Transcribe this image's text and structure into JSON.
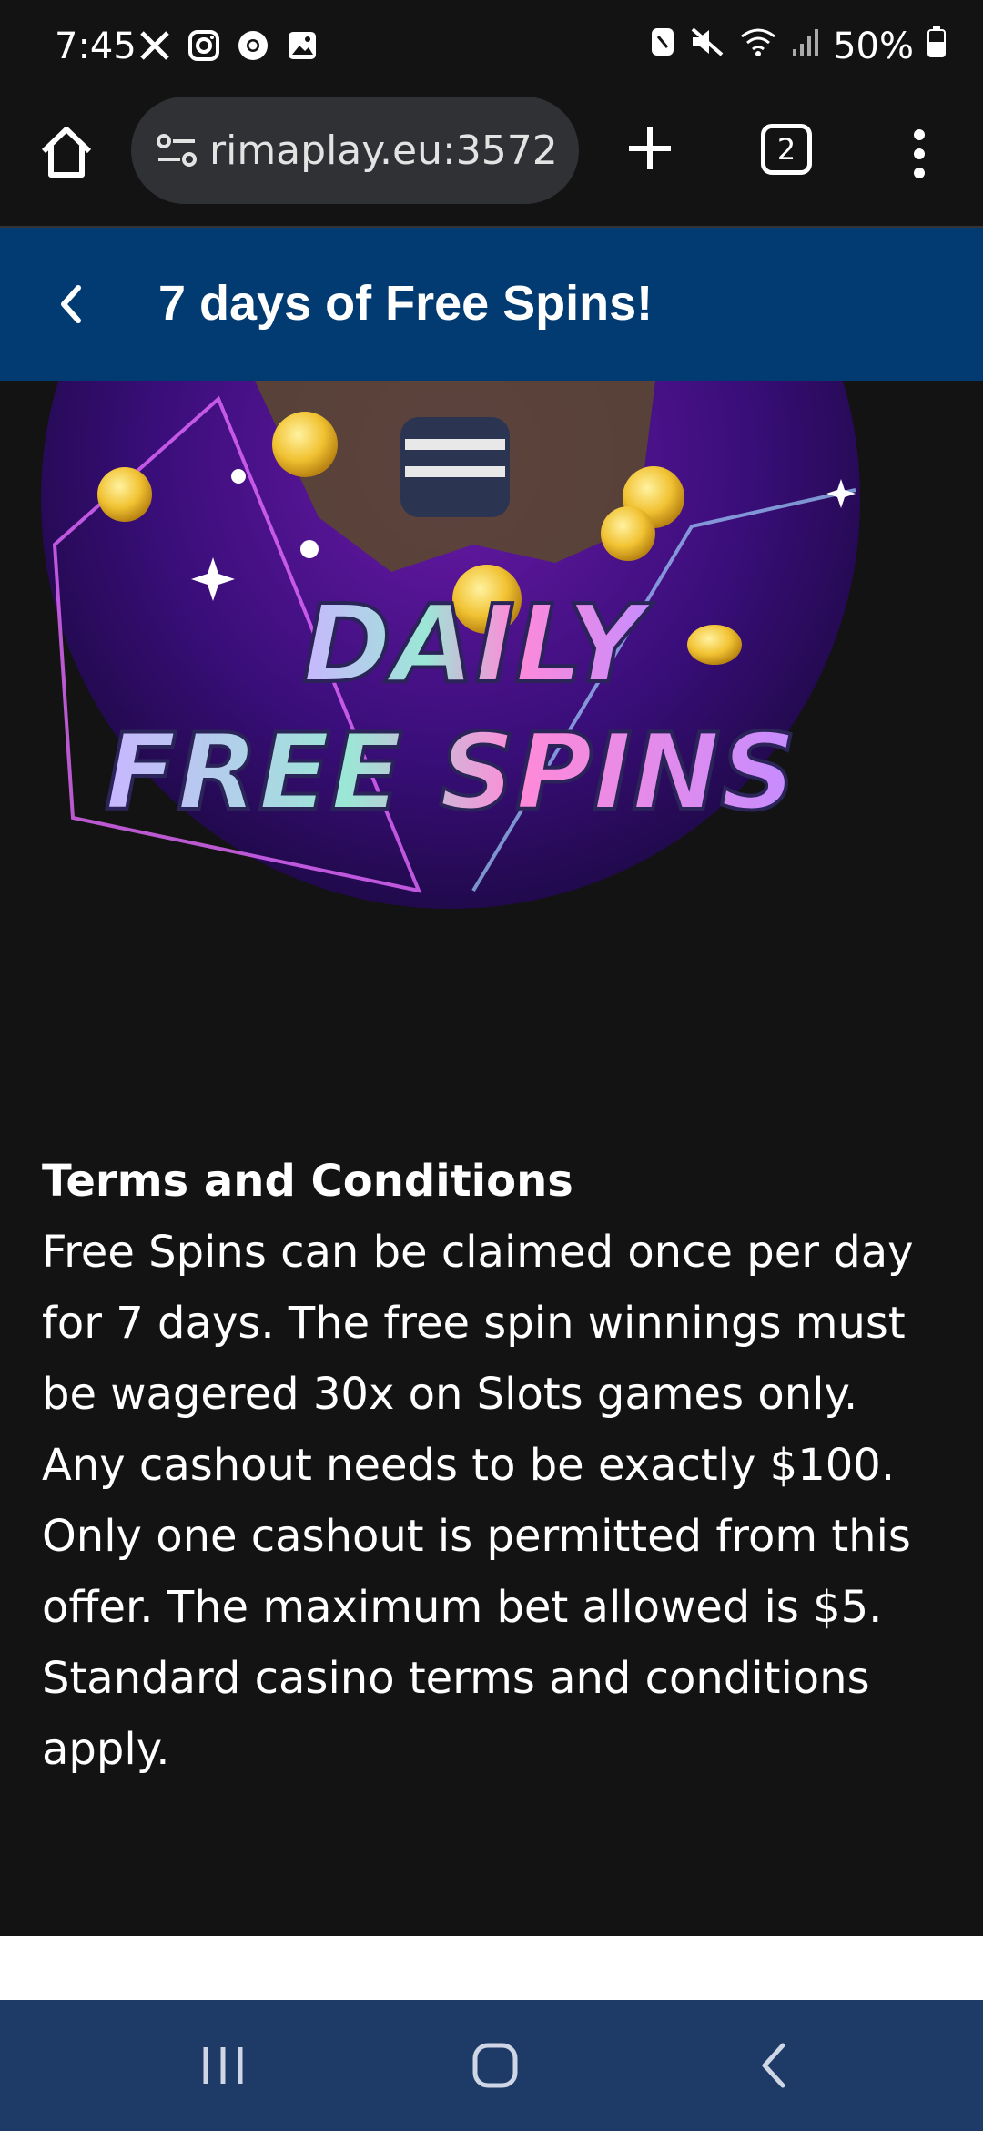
{
  "status_bar": {
    "time": "7:45",
    "battery": "50%",
    "left_icons": [
      "x-icon",
      "instagram-icon",
      "chrome-icon",
      "gallery-icon"
    ],
    "right_icons": [
      "nfc-icon",
      "mute-icon",
      "wifi-icon",
      "signal-icon",
      "battery-icon"
    ]
  },
  "browser": {
    "url": "rimaplay.eu:3572",
    "tab_count": "2"
  },
  "page": {
    "title": "7 days of Free Spins!"
  },
  "promo": {
    "line1": "DAILY",
    "line2": "FREE SPINS"
  },
  "terms": {
    "heading": "Terms and Conditions",
    "body": "Free Spins can be claimed once per day for 7 days. The free spin winnings must be wagered 30x on Slots games only. Any cashout needs to be exactly $100. Only one cashout is permitted from this offer. The maximum bet allowed is $5. Standard casino terms and conditions apply."
  },
  "colors": {
    "background": "#131314",
    "header": "#023b72",
    "navbar": "#1e3a66",
    "url_pill": "#303134"
  }
}
